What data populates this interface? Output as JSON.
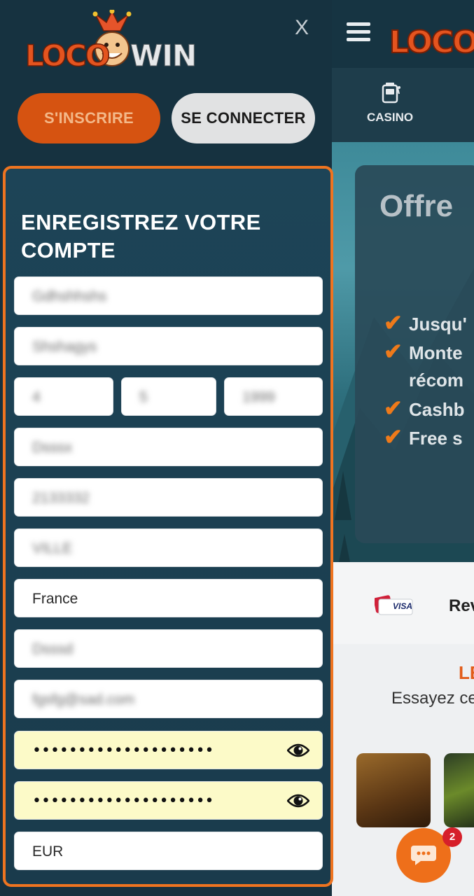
{
  "drawer": {
    "logo_text_left": "LOCO",
    "logo_text_right": "WIN",
    "close_label": "X",
    "signup_label": "S'INSCRIRE",
    "login_label": "SE CONNECTER"
  },
  "form": {
    "title": "ENREGISTREZ VOTRE COMPTE",
    "fields": {
      "first_name": "Gdhshhshs",
      "last_name": "Shshagys",
      "birth_day": "4",
      "birth_month": "5",
      "birth_year": "1999",
      "address": "Dsssx",
      "postal_code": "2133332",
      "city": "VILLE",
      "country": "France",
      "phone": "Dsssd",
      "email": "fgsfg@sad.com",
      "password": "••••••••••••••••••••",
      "password_confirm": "••••••••••••••••••••",
      "currency": "EUR"
    }
  },
  "background": {
    "casino_label": "CASINO",
    "offer_title": "Offre",
    "benefits": [
      "Jusqu'",
      "Monte",
      "récom",
      "Cashb",
      "Free s"
    ],
    "payment_visa": "VISA",
    "payment_rev": "Rev",
    "games_title": "LE",
    "games_subtitle": "Essayez ce",
    "chat_badge": "2"
  },
  "colors": {
    "accent_orange": "#ef7420",
    "signup_bg": "#d65311",
    "password_bg": "#fcfac8",
    "drawer_bg": "#17313f"
  }
}
